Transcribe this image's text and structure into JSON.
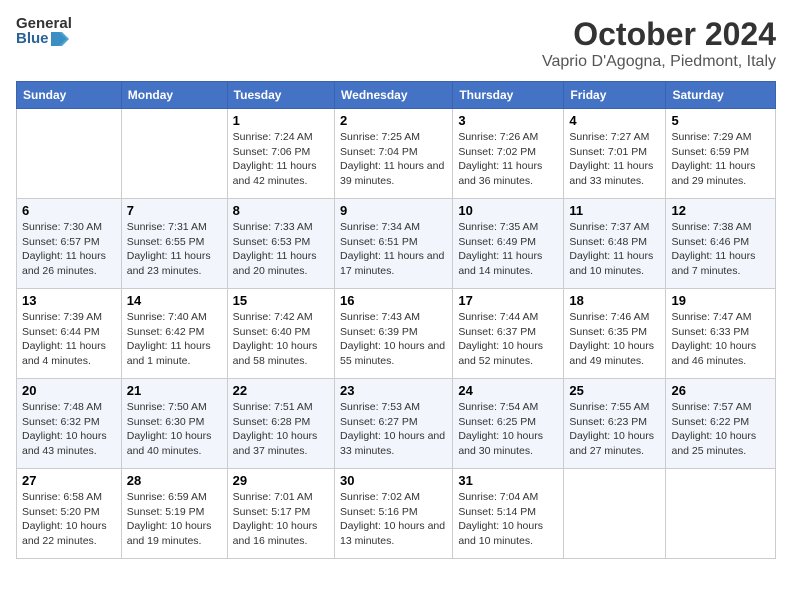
{
  "logo": {
    "general": "General",
    "blue": "Blue"
  },
  "title": "October 2024",
  "subtitle": "Vaprio D'Agogna, Piedmont, Italy",
  "headers": [
    "Sunday",
    "Monday",
    "Tuesday",
    "Wednesday",
    "Thursday",
    "Friday",
    "Saturday"
  ],
  "weeks": [
    [
      {
        "day": "",
        "sunrise": "",
        "sunset": "",
        "daylight": ""
      },
      {
        "day": "",
        "sunrise": "",
        "sunset": "",
        "daylight": ""
      },
      {
        "day": "1",
        "sunrise": "Sunrise: 7:24 AM",
        "sunset": "Sunset: 7:06 PM",
        "daylight": "Daylight: 11 hours and 42 minutes."
      },
      {
        "day": "2",
        "sunrise": "Sunrise: 7:25 AM",
        "sunset": "Sunset: 7:04 PM",
        "daylight": "Daylight: 11 hours and 39 minutes."
      },
      {
        "day": "3",
        "sunrise": "Sunrise: 7:26 AM",
        "sunset": "Sunset: 7:02 PM",
        "daylight": "Daylight: 11 hours and 36 minutes."
      },
      {
        "day": "4",
        "sunrise": "Sunrise: 7:27 AM",
        "sunset": "Sunset: 7:01 PM",
        "daylight": "Daylight: 11 hours and 33 minutes."
      },
      {
        "day": "5",
        "sunrise": "Sunrise: 7:29 AM",
        "sunset": "Sunset: 6:59 PM",
        "daylight": "Daylight: 11 hours and 29 minutes."
      }
    ],
    [
      {
        "day": "6",
        "sunrise": "Sunrise: 7:30 AM",
        "sunset": "Sunset: 6:57 PM",
        "daylight": "Daylight: 11 hours and 26 minutes."
      },
      {
        "day": "7",
        "sunrise": "Sunrise: 7:31 AM",
        "sunset": "Sunset: 6:55 PM",
        "daylight": "Daylight: 11 hours and 23 minutes."
      },
      {
        "day": "8",
        "sunrise": "Sunrise: 7:33 AM",
        "sunset": "Sunset: 6:53 PM",
        "daylight": "Daylight: 11 hours and 20 minutes."
      },
      {
        "day": "9",
        "sunrise": "Sunrise: 7:34 AM",
        "sunset": "Sunset: 6:51 PM",
        "daylight": "Daylight: 11 hours and 17 minutes."
      },
      {
        "day": "10",
        "sunrise": "Sunrise: 7:35 AM",
        "sunset": "Sunset: 6:49 PM",
        "daylight": "Daylight: 11 hours and 14 minutes."
      },
      {
        "day": "11",
        "sunrise": "Sunrise: 7:37 AM",
        "sunset": "Sunset: 6:48 PM",
        "daylight": "Daylight: 11 hours and 10 minutes."
      },
      {
        "day": "12",
        "sunrise": "Sunrise: 7:38 AM",
        "sunset": "Sunset: 6:46 PM",
        "daylight": "Daylight: 11 hours and 7 minutes."
      }
    ],
    [
      {
        "day": "13",
        "sunrise": "Sunrise: 7:39 AM",
        "sunset": "Sunset: 6:44 PM",
        "daylight": "Daylight: 11 hours and 4 minutes."
      },
      {
        "day": "14",
        "sunrise": "Sunrise: 7:40 AM",
        "sunset": "Sunset: 6:42 PM",
        "daylight": "Daylight: 11 hours and 1 minute."
      },
      {
        "day": "15",
        "sunrise": "Sunrise: 7:42 AM",
        "sunset": "Sunset: 6:40 PM",
        "daylight": "Daylight: 10 hours and 58 minutes."
      },
      {
        "day": "16",
        "sunrise": "Sunrise: 7:43 AM",
        "sunset": "Sunset: 6:39 PM",
        "daylight": "Daylight: 10 hours and 55 minutes."
      },
      {
        "day": "17",
        "sunrise": "Sunrise: 7:44 AM",
        "sunset": "Sunset: 6:37 PM",
        "daylight": "Daylight: 10 hours and 52 minutes."
      },
      {
        "day": "18",
        "sunrise": "Sunrise: 7:46 AM",
        "sunset": "Sunset: 6:35 PM",
        "daylight": "Daylight: 10 hours and 49 minutes."
      },
      {
        "day": "19",
        "sunrise": "Sunrise: 7:47 AM",
        "sunset": "Sunset: 6:33 PM",
        "daylight": "Daylight: 10 hours and 46 minutes."
      }
    ],
    [
      {
        "day": "20",
        "sunrise": "Sunrise: 7:48 AM",
        "sunset": "Sunset: 6:32 PM",
        "daylight": "Daylight: 10 hours and 43 minutes."
      },
      {
        "day": "21",
        "sunrise": "Sunrise: 7:50 AM",
        "sunset": "Sunset: 6:30 PM",
        "daylight": "Daylight: 10 hours and 40 minutes."
      },
      {
        "day": "22",
        "sunrise": "Sunrise: 7:51 AM",
        "sunset": "Sunset: 6:28 PM",
        "daylight": "Daylight: 10 hours and 37 minutes."
      },
      {
        "day": "23",
        "sunrise": "Sunrise: 7:53 AM",
        "sunset": "Sunset: 6:27 PM",
        "daylight": "Daylight: 10 hours and 33 minutes."
      },
      {
        "day": "24",
        "sunrise": "Sunrise: 7:54 AM",
        "sunset": "Sunset: 6:25 PM",
        "daylight": "Daylight: 10 hours and 30 minutes."
      },
      {
        "day": "25",
        "sunrise": "Sunrise: 7:55 AM",
        "sunset": "Sunset: 6:23 PM",
        "daylight": "Daylight: 10 hours and 27 minutes."
      },
      {
        "day": "26",
        "sunrise": "Sunrise: 7:57 AM",
        "sunset": "Sunset: 6:22 PM",
        "daylight": "Daylight: 10 hours and 25 minutes."
      }
    ],
    [
      {
        "day": "27",
        "sunrise": "Sunrise: 6:58 AM",
        "sunset": "Sunset: 5:20 PM",
        "daylight": "Daylight: 10 hours and 22 minutes."
      },
      {
        "day": "28",
        "sunrise": "Sunrise: 6:59 AM",
        "sunset": "Sunset: 5:19 PM",
        "daylight": "Daylight: 10 hours and 19 minutes."
      },
      {
        "day": "29",
        "sunrise": "Sunrise: 7:01 AM",
        "sunset": "Sunset: 5:17 PM",
        "daylight": "Daylight: 10 hours and 16 minutes."
      },
      {
        "day": "30",
        "sunrise": "Sunrise: 7:02 AM",
        "sunset": "Sunset: 5:16 PM",
        "daylight": "Daylight: 10 hours and 13 minutes."
      },
      {
        "day": "31",
        "sunrise": "Sunrise: 7:04 AM",
        "sunset": "Sunset: 5:14 PM",
        "daylight": "Daylight: 10 hours and 10 minutes."
      },
      {
        "day": "",
        "sunrise": "",
        "sunset": "",
        "daylight": ""
      },
      {
        "day": "",
        "sunrise": "",
        "sunset": "",
        "daylight": ""
      }
    ]
  ]
}
